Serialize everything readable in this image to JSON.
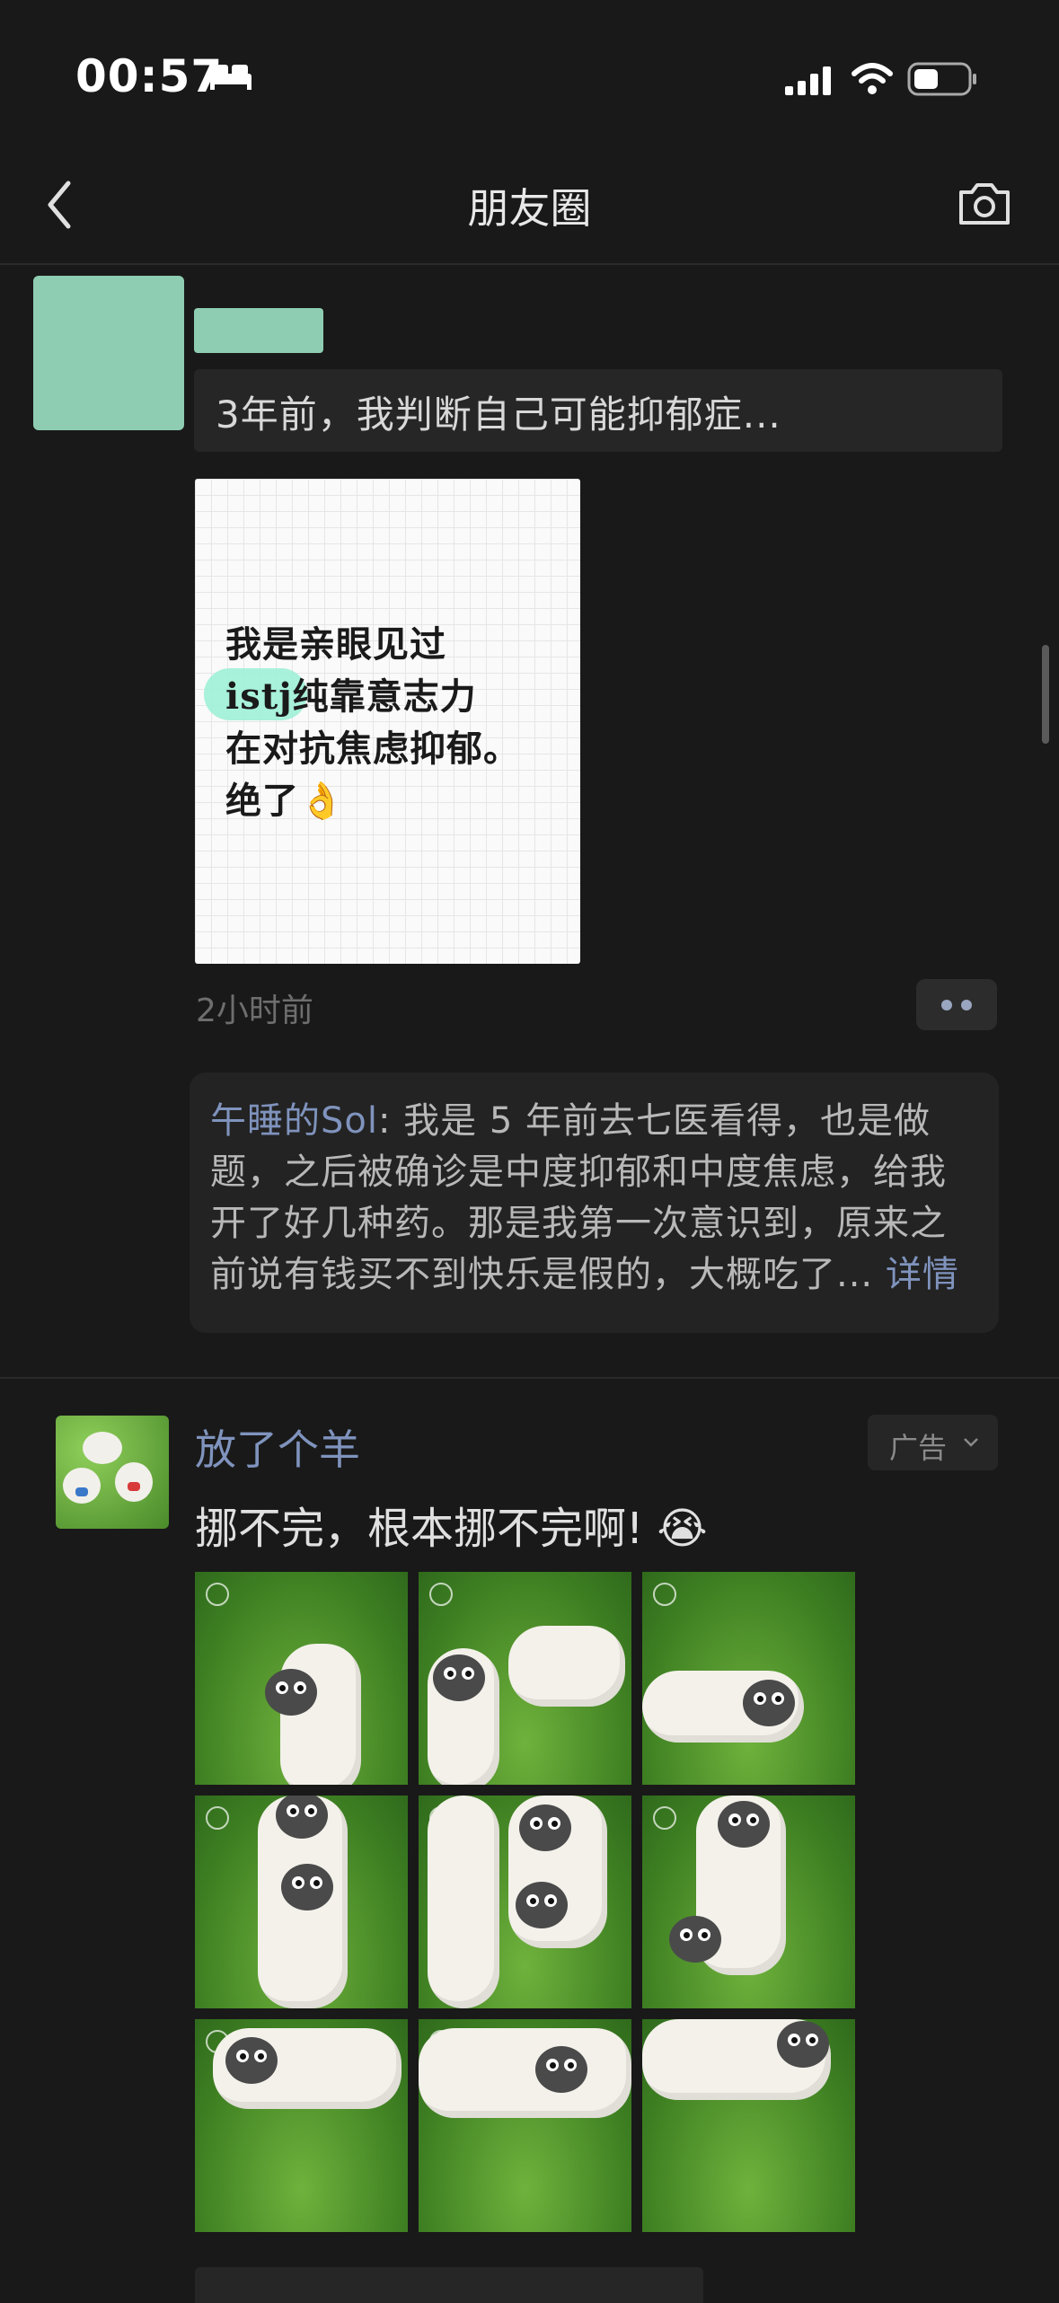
{
  "status_bar": {
    "time": "00:57"
  },
  "nav": {
    "title": "朋友圈"
  },
  "post1": {
    "link_text": "3年前，我判断自己可能抑郁症...",
    "image_lines": [
      "我是亲眼见过",
      "istj纯靠意志力",
      "在对抗焦虑抑郁。",
      "绝了👌"
    ],
    "time": "2小时前",
    "comment": {
      "author": "午睡的Sol",
      "text": ": 我是 5 年前去七医看得，也是做题，之后被确诊是中度抑郁和中度焦虑，给我开了好几种药。那是我第一次意识到，原来之前说有钱买不到快乐是假的，大概吃了...",
      "more": " 详情"
    }
  },
  "post2": {
    "name": "放了个羊",
    "ad_label": "广告",
    "caption": "挪不完，根本挪不完啊! 😭"
  },
  "colors": {
    "background": "#191919",
    "link": "#7f93bd",
    "avatar_placeholder": "#8ecdb1"
  }
}
